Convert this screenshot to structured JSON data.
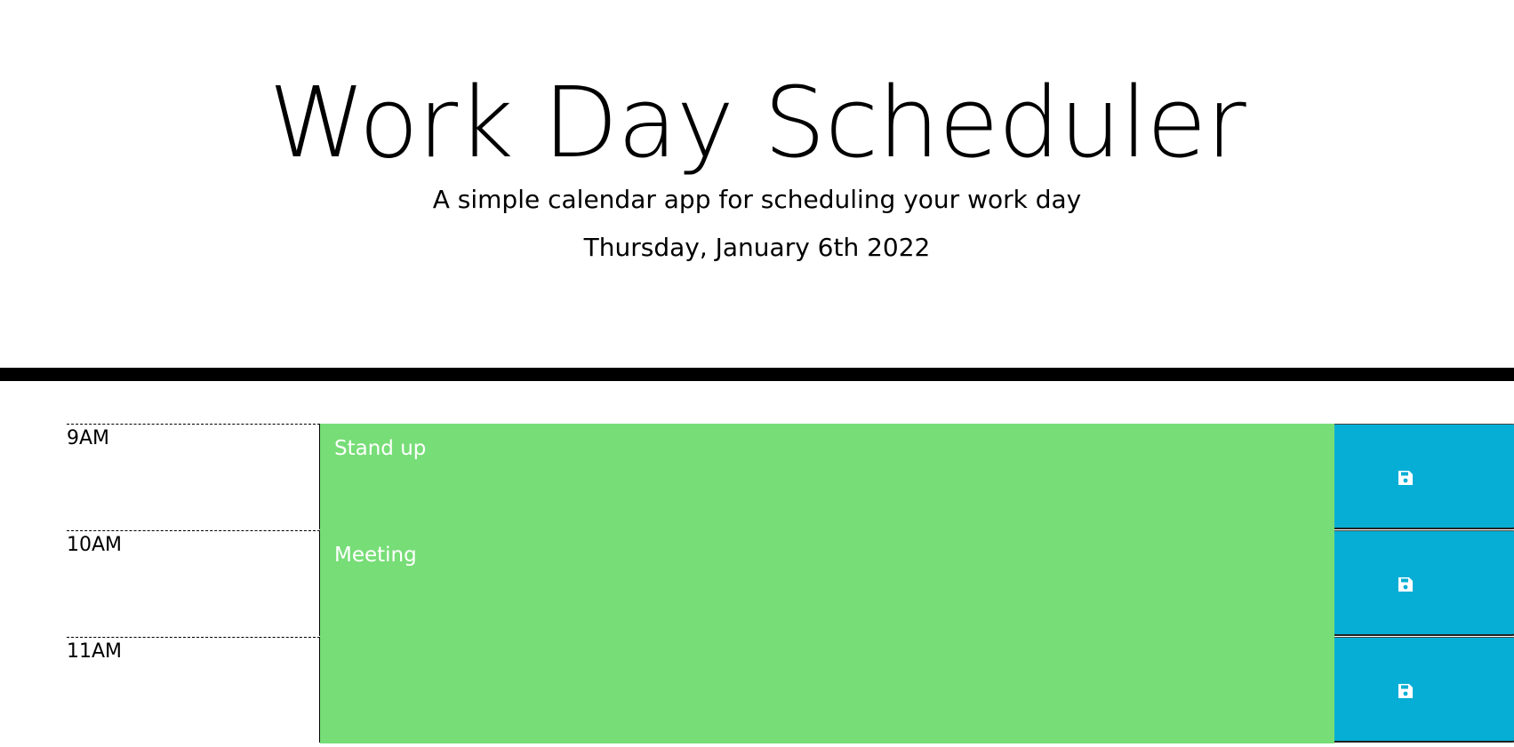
{
  "header": {
    "title": "Work Day Scheduler",
    "description": "A simple calendar app for scheduling your work day",
    "current_day": "Thursday, January 6th 2022"
  },
  "colors": {
    "present": "#77dd77",
    "save_button": "#06aed5",
    "divider": "#000000"
  },
  "time_blocks": [
    {
      "hour": "9AM",
      "text": "Stand up",
      "save_icon": "floppy-disk-icon"
    },
    {
      "hour": "10AM",
      "text": "Meeting",
      "save_icon": "floppy-disk-icon"
    },
    {
      "hour": "11AM",
      "text": "",
      "save_icon": "floppy-disk-icon"
    }
  ]
}
